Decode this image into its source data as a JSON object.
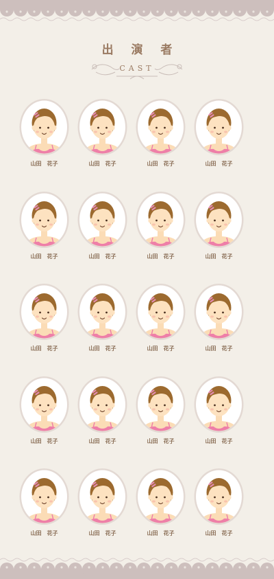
{
  "header": {
    "title": "出 演 者",
    "subtitle": "CAST"
  },
  "colors": {
    "background": "#f3efe8",
    "lace": "#c8b8b8",
    "text": "#9a7a62"
  },
  "cast": [
    {
      "name": "山田　花子"
    },
    {
      "name": "山田　花子"
    },
    {
      "name": "山田　花子"
    },
    {
      "name": "山田　花子"
    },
    {
      "name": "山田　花子"
    },
    {
      "name": "山田　花子"
    },
    {
      "name": "山田　花子"
    },
    {
      "name": "山田　花子"
    },
    {
      "name": "山田　花子"
    },
    {
      "name": "山田　花子"
    },
    {
      "name": "山田　花子"
    },
    {
      "name": "山田　花子"
    },
    {
      "name": "山田　花子"
    },
    {
      "name": "山田　花子"
    },
    {
      "name": "山田　花子"
    },
    {
      "name": "山田　花子"
    },
    {
      "name": "山田　花子"
    },
    {
      "name": "山田　花子"
    },
    {
      "name": "山田　花子"
    },
    {
      "name": "山田　花子"
    }
  ]
}
